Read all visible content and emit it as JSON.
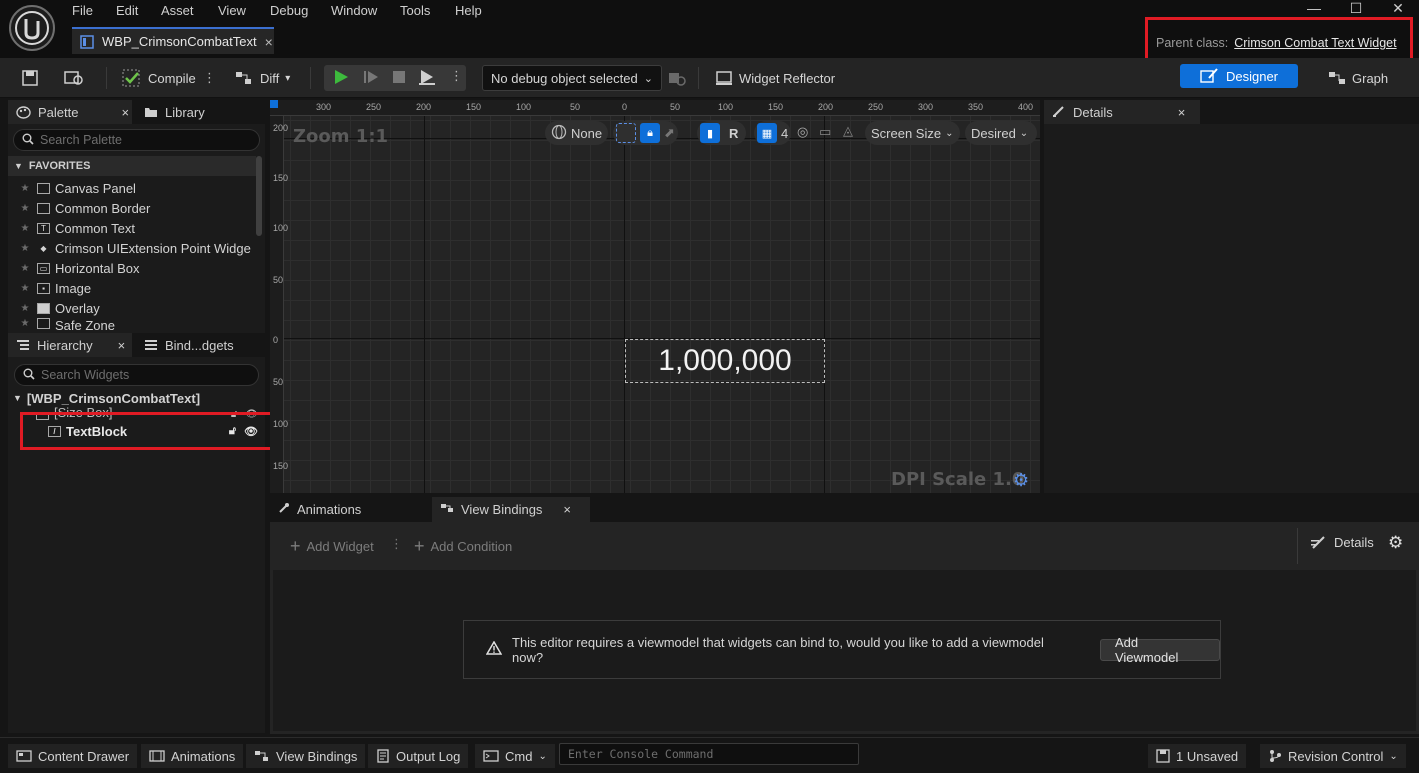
{
  "menu": [
    "File",
    "Edit",
    "Asset",
    "View",
    "Debug",
    "Window",
    "Tools",
    "Help"
  ],
  "document_tab": {
    "label": "WBP_CrimsonCombatText",
    "close": "×"
  },
  "window_controls": {
    "minimize": "—",
    "maximize": "☐",
    "close": "✕"
  },
  "parent_class": {
    "label": "Parent class:",
    "value": "Crimson Combat Text Widget"
  },
  "toolbar": {
    "compile": "Compile",
    "diff": "Diff",
    "debug_object": "No debug object selected",
    "widget_reflector": "Widget Reflector",
    "designer": "Designer",
    "graph": "Graph"
  },
  "palette": {
    "tab": "Palette",
    "library_tab": "Library",
    "search_placeholder": "Search Palette",
    "section": "FAVORITES",
    "items": [
      "Canvas Panel",
      "Common Border",
      "Common Text",
      "Crimson UIExtension Point Widge",
      "Horizontal Box",
      "Image",
      "Overlay",
      "Safe Zone"
    ]
  },
  "hierarchy": {
    "tab": "Hierarchy",
    "bindings_tab": "Bind...dgets",
    "search_placeholder": "Search Widgets",
    "root": "[WBP_CrimsonCombatText]",
    "items": [
      "[Size Box]",
      "TextBlock"
    ]
  },
  "canvas": {
    "zoom": "Zoom 1:1",
    "dpi": "DPI Scale 1.0",
    "none_label": "None",
    "r_label": "R",
    "grid_snap": "4",
    "screen_size": "Screen Size",
    "desired": "Desired",
    "ruler_top": [
      "300",
      "250",
      "200",
      "150",
      "100",
      "50",
      "0",
      "50",
      "100",
      "150",
      "200",
      "250",
      "300",
      "350",
      "400"
    ],
    "ruler_left": [
      "200",
      "150",
      "100",
      "50",
      "0",
      "50",
      "100",
      "150"
    ],
    "widget_text": "1,000,000"
  },
  "details": {
    "tab": "Details"
  },
  "bottom": {
    "animations_tab": "Animations",
    "view_bindings_tab": "View Bindings",
    "add_widget": "Add Widget",
    "add_condition": "Add Condition",
    "details": "Details",
    "notice": "This editor requires a viewmodel that widgets can bind to, would you like to add a viewmodel now?",
    "add_viewmodel": "Add Viewmodel"
  },
  "statusbar": {
    "content_drawer": "Content Drawer",
    "animations": "Animations",
    "view_bindings": "View Bindings",
    "output_log": "Output Log",
    "cmd": "Cmd",
    "console_placeholder": "Enter Console Command",
    "unsaved": "1 Unsaved",
    "revision_control": "Revision Control"
  },
  "colors": {
    "accent": "#0e6fd9",
    "highlight": "#e01b24",
    "play": "#3dbb3d"
  }
}
